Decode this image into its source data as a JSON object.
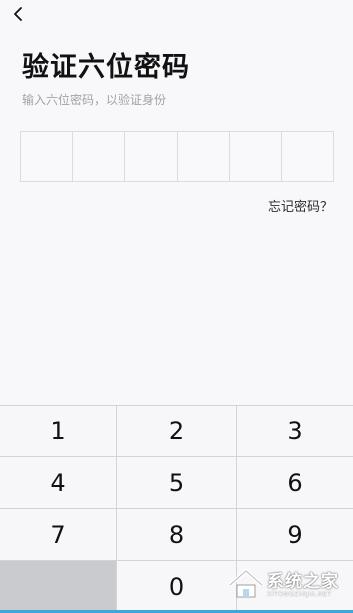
{
  "header": {
    "title": "验证六位密码",
    "subtitle": "输入六位密码，以验证身份"
  },
  "pin": {
    "length": 6,
    "entered": 0
  },
  "forgot_link": "忘记密码？",
  "keypad": {
    "keys": [
      "1",
      "2",
      "3",
      "4",
      "5",
      "6",
      "7",
      "8",
      "9",
      "",
      "0",
      ""
    ]
  },
  "watermark": {
    "brand": "系统之家",
    "url": "XITONGZHIJIA.NET"
  },
  "colors": {
    "background": "#f8f7fa",
    "subtitle": "#a3a2a6",
    "accent_line": "#3fa6d6",
    "blank_key": "#c9cbcf"
  },
  "icons": {
    "back": "chevron-left-icon"
  }
}
